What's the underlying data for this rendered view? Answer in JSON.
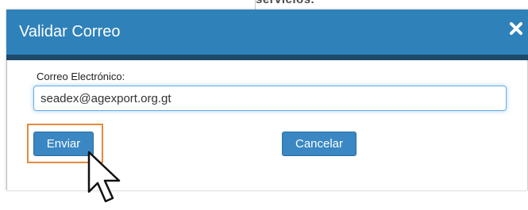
{
  "backdrop": {
    "partial_text": "servicios."
  },
  "dialog": {
    "title": "Validar Correo",
    "close_icon": "close-icon",
    "header_color": "#2f81b9",
    "header_strip_color": "#1c4a68"
  },
  "form": {
    "email_label": "Correo Electrónico:",
    "email_value": "seadex@agexport.org.gt"
  },
  "buttons": {
    "send_label": "Enviar",
    "cancel_label": "Cancelar",
    "button_color": "#3a87c3",
    "highlight_color": "#e68a3a"
  },
  "overlay": {
    "pointer_icon": "mouse-pointer-icon"
  }
}
